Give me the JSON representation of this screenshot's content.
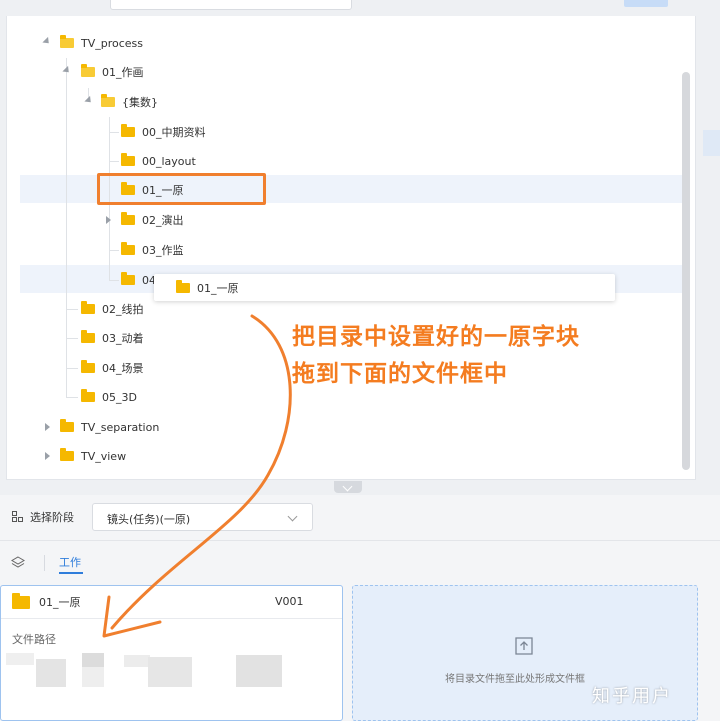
{
  "tree": {
    "items": [
      {
        "label": "TV_process"
      },
      {
        "label": "01_作画"
      },
      {
        "label": "{集数}"
      },
      {
        "label": "00_中期资料"
      },
      {
        "label": "00_layout"
      },
      {
        "label": "01_一原"
      },
      {
        "label": "02_演出"
      },
      {
        "label": "03_作监"
      },
      {
        "label": "04"
      },
      {
        "label": "02_线拍"
      },
      {
        "label": "03_动着"
      },
      {
        "label": "04_场景"
      },
      {
        "label": "05_3D"
      },
      {
        "label": "TV_separation"
      },
      {
        "label": "TV_view"
      }
    ],
    "drag_ghost_label": "01_一原"
  },
  "annotation": {
    "line1": "把目录中设置好的一原字块",
    "line2": "拖到下面的文件框中"
  },
  "stage": {
    "label": "选择阶段",
    "selected": "镜头(任务)(一原)"
  },
  "tabs": {
    "work": "工作"
  },
  "file_card": {
    "title": "01_一原",
    "version": "V001",
    "path_label": "文件路径"
  },
  "drop_zone": {
    "text": "将目录文件拖至此处形成文件框"
  },
  "watermark": "知乎用户",
  "colors": {
    "accent": "#2f7ddb",
    "annotation": "#f47c20",
    "folder": "#f5b800"
  }
}
